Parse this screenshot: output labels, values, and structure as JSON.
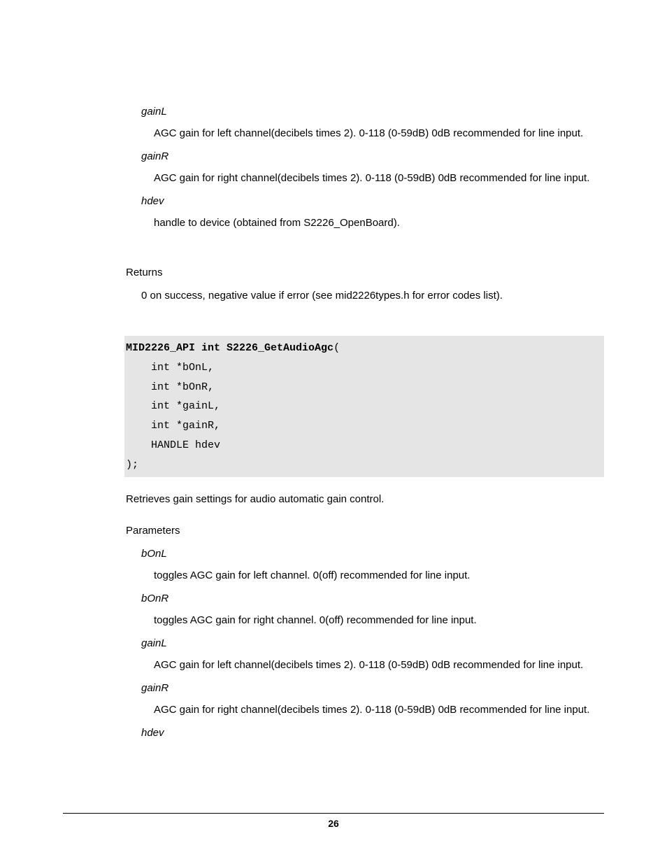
{
  "section1": {
    "params": [
      {
        "name": "gainL",
        "desc": "AGC gain for left channel(decibels times 2). 0-118 (0-59dB) 0dB recommended for line input."
      },
      {
        "name": "gainR",
        "desc": "AGC gain for right channel(decibels times 2). 0-118 (0-59dB) 0dB recommended for line input."
      },
      {
        "name": "hdev",
        "desc": "handle to device (obtained from S2226_OpenBoard)."
      }
    ],
    "returnsLabel": "Returns",
    "returnsDesc": "0 on success, negative value if error (see mid2226types.h for error codes list)."
  },
  "codeBlock": {
    "signature": "MID2226_API int S2226_GetAudioAgc",
    "openParen": "(",
    "lines": [
      "    int *bOnL,",
      "    int *bOnR,",
      "    int *gainL,",
      "    int *gainR,",
      "    HANDLE hdev",
      ");"
    ]
  },
  "section2": {
    "desc": "Retrieves gain settings for audio automatic gain control.",
    "paramsLabel": "Parameters",
    "params": [
      {
        "name": "bOnL",
        "desc": "toggles AGC gain for left channel. 0(off) recommended for line input."
      },
      {
        "name": "bOnR",
        "desc": "toggles AGC gain for right channel. 0(off) recommended for line input."
      },
      {
        "name": "gainL",
        "desc": "AGC gain for left channel(decibels times 2). 0-118 (0-59dB) 0dB recommended for line input."
      },
      {
        "name": "gainR",
        "desc": "AGC gain for right channel(decibels times 2). 0-118 (0-59dB) 0dB recommended for line input."
      },
      {
        "name": "hdev",
        "desc": ""
      }
    ]
  },
  "pageNumber": "26"
}
